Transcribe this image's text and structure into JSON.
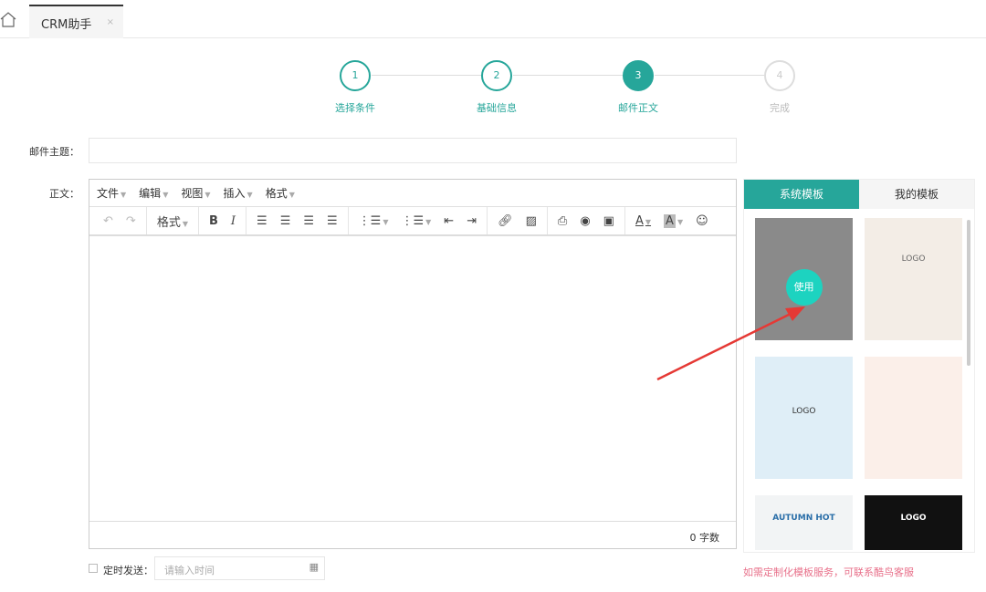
{
  "tabs": {
    "active": "CRM助手",
    "close": "×"
  },
  "steps": [
    {
      "num": "1",
      "label": "选择条件",
      "state": "done"
    },
    {
      "num": "2",
      "label": "基础信息",
      "state": "done"
    },
    {
      "num": "3",
      "label": "邮件正文",
      "state": "active"
    },
    {
      "num": "4",
      "label": "完成",
      "state": "todo"
    }
  ],
  "form": {
    "subject_label": "邮件主题：",
    "subject_value": "",
    "body_label": "正文：",
    "schedule_label": "定时发送：",
    "schedule_placeholder": "请输入时间"
  },
  "editor": {
    "menus": [
      "文件",
      "编辑",
      "视图",
      "插入",
      "格式"
    ],
    "format_label": "格式",
    "word_count": "0 字数"
  },
  "panel": {
    "tabs": [
      "系统模板",
      "我的模板"
    ],
    "use_label": "使用",
    "logo": "LOGO",
    "autumn": "AUTUMN HOT",
    "footer": "如需定制化模板服务，可联系酷鸟客服"
  },
  "colors": {
    "accent": "#26a69a",
    "use_button": "#1dd3c0",
    "footer_text": "#e8708a",
    "arrow": "#e53935"
  }
}
